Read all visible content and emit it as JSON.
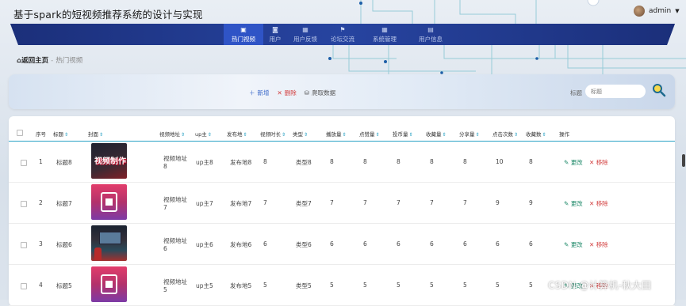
{
  "app": {
    "title": "基于spark的短视频推荐系统的设计与实现"
  },
  "user": {
    "name": "admin"
  },
  "nav": {
    "items": [
      {
        "label": "热门视频",
        "icon": "video-icon",
        "active": true
      },
      {
        "label": "用户",
        "icon": "user-icon",
        "active": false
      },
      {
        "label": "用户反馈",
        "icon": "grid-icon",
        "active": false
      },
      {
        "label": "论坛交流",
        "icon": "flag-icon",
        "active": false
      },
      {
        "label": "系统管理",
        "icon": "grid-icon",
        "active": false
      },
      {
        "label": "用户信息",
        "icon": "calendar-icon",
        "active": false
      }
    ]
  },
  "breadcrumb": {
    "home": "返回主页",
    "current": "热门视频"
  },
  "toolbar": {
    "add": "新增",
    "delete": "删除",
    "crawl": "爬取数据"
  },
  "search": {
    "label": "标题",
    "placeholder": "标题"
  },
  "table": {
    "headers": [
      "序号",
      "标题",
      "封面",
      "视频地址",
      "up主",
      "发布地",
      "视频时长",
      "类型",
      "播放量",
      "点赞量",
      "投币量",
      "收藏量",
      "分享量",
      "点击次数",
      "收藏数",
      "操作"
    ],
    "edit_label": "更改",
    "remove_label": "移除",
    "rows": [
      {
        "no": "1",
        "title": "标题8",
        "cover": "dark",
        "url": [
          "视频地址",
          "8"
        ],
        "up": "up主8",
        "place": "发布地8",
        "duration": "8",
        "type": "类型8",
        "plays": "8",
        "likes": "8",
        "coins": "8",
        "favs": "8",
        "shares": "8",
        "clicks": "10",
        "favcount": "8"
      },
      {
        "no": "2",
        "title": "标题7",
        "cover": "pink",
        "url": [
          "视频地址",
          "7"
        ],
        "up": "up主7",
        "place": "发布地7",
        "duration": "7",
        "type": "类型7",
        "plays": "7",
        "likes": "7",
        "coins": "7",
        "favs": "7",
        "shares": "7",
        "clicks": "9",
        "favcount": "9"
      },
      {
        "no": "3",
        "title": "标题6",
        "cover": "studio",
        "url": [
          "视频地址",
          "6"
        ],
        "up": "up主6",
        "place": "发布地6",
        "duration": "6",
        "type": "类型6",
        "plays": "6",
        "likes": "6",
        "coins": "6",
        "favs": "6",
        "shares": "6",
        "clicks": "6",
        "favcount": "6"
      },
      {
        "no": "4",
        "title": "标题5",
        "cover": "pink",
        "url": [
          "视频地址",
          "5"
        ],
        "up": "up主5",
        "place": "发布地5",
        "duration": "5",
        "type": "类型5",
        "plays": "5",
        "likes": "5",
        "coins": "5",
        "favs": "5",
        "shares": "5",
        "clicks": "5",
        "favcount": "5"
      }
    ]
  },
  "cover_text": {
    "dark": "视频制作"
  },
  "watermark": "CSDN @计算机-秋大田",
  "colors": {
    "nav": "#203a8e",
    "nav_active": "#2f54c6",
    "accent": "#2aa2c5",
    "edit": "#1f8a6a",
    "remove": "#d23c3c"
  }
}
